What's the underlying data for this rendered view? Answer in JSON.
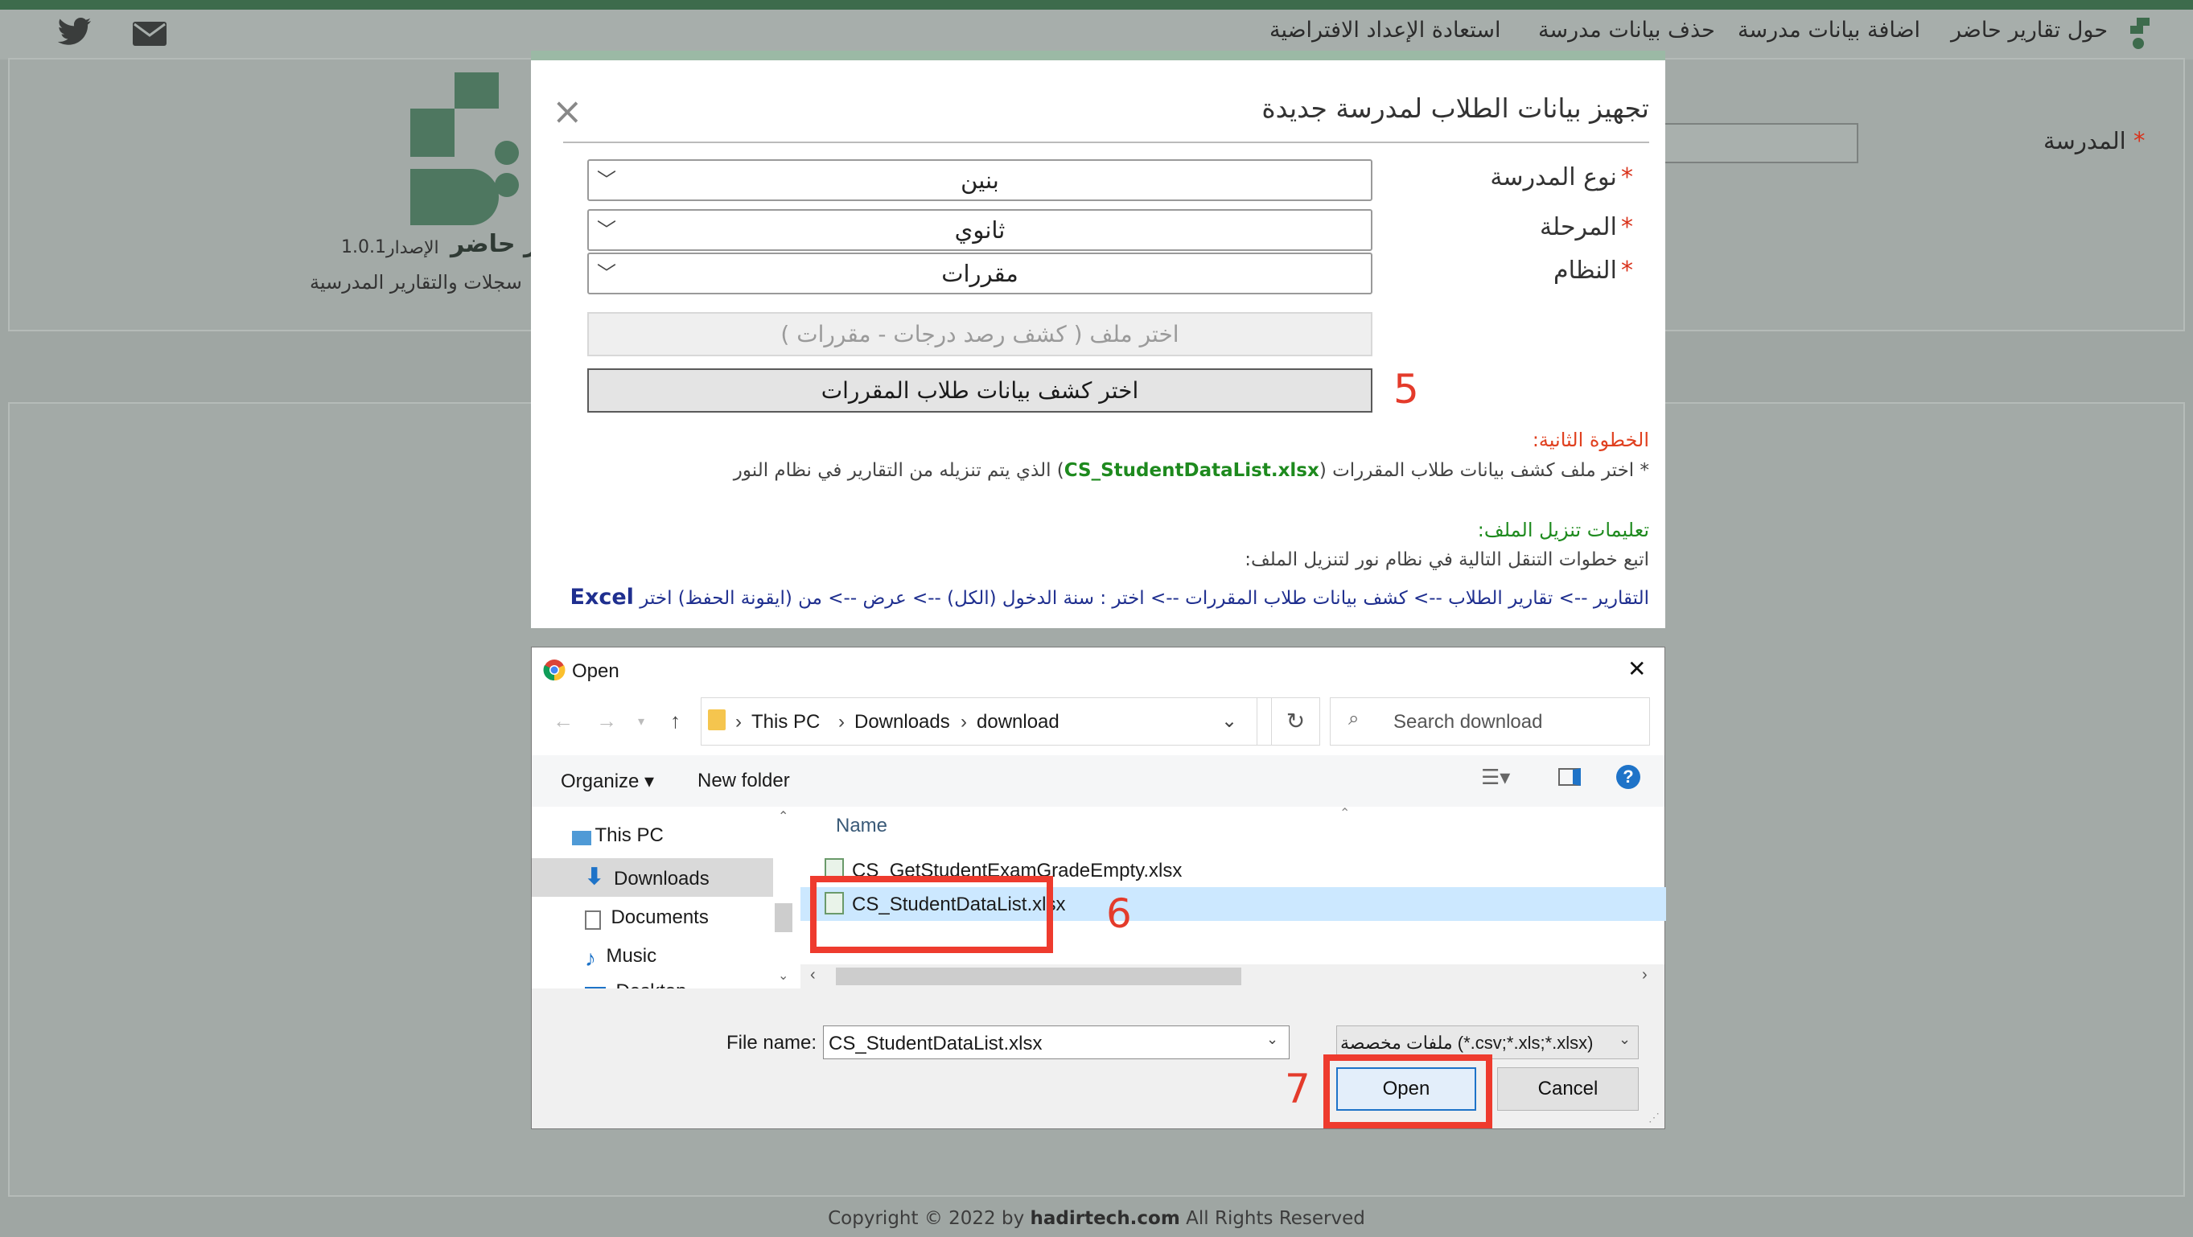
{
  "nav": {
    "items": [
      "حول تقارير حاضر",
      "اضافة بيانات مدرسة",
      "حذف بيانات مدرسة",
      "استعادة الإعداد الافتراضية"
    ]
  },
  "page": {
    "school_label": "المدرسة",
    "brand_name": "ير حاضر",
    "version_label": "الإصدار",
    "version_number": "1.0.1",
    "tagline": "سجلات والتقارير المدرسية"
  },
  "modal": {
    "title": "تجهيز بيانات الطلاب لمدرسة جديدة",
    "close_symbol": "×",
    "required_mark": "*",
    "fields": [
      {
        "label": "نوع المدرسة",
        "value": "بنين"
      },
      {
        "label": "المرحلة",
        "value": "ثانوي"
      },
      {
        "label": "النظام",
        "value": "مقررات"
      }
    ],
    "file_button_disabled": "اختر ملف ( كشف رصد درجات - مقررات )",
    "file_button_active": "اختر كشف بيانات طلاب المقررات",
    "step_heading": "الخطوة الثانية:",
    "step_text_before": "* اختر ملف كشف بيانات طلاب المقررات (",
    "step_filename": "CS_StudentDataList.xlsx",
    "step_text_after": ") الذي يتم تنزيله من التقارير في نظام النور",
    "download_heading": "تعليمات تنزيل الملف:",
    "download_intro": "اتبع خطوات التنقل التالية في نظام نور لتنزيل الملف:",
    "nav_path": "التقارير --> تقارير الطلاب --> كشف بيانات طلاب المقررات --> اختر : سنة الدخول (الكل) --> عرض --> من (ايقونة الحفظ) اختر",
    "nav_path_excel": "Excel"
  },
  "dialog": {
    "title": "Open",
    "close_symbol": "✕",
    "breadcrumb": [
      "This PC",
      "Downloads",
      "download"
    ],
    "search_placeholder": "Search download",
    "organize_label": "Organize ▾",
    "new_folder_label": "New folder",
    "help_symbol": "?",
    "sidebar": [
      "This PC",
      "Downloads",
      "Documents",
      "Music",
      "Desktop"
    ],
    "column_name": "Name",
    "files": [
      "CS_GetStudentExamGradeEmpty.xlsx",
      "CS_StudentDataList.xlsx"
    ],
    "filename_label": "File name:",
    "filename_value": "CS_StudentDataList.xlsx",
    "filetype_value": "ملفات مخصصة (*.csv;*.xls;*.xlsx)",
    "open_label": "Open",
    "cancel_label": "Cancel"
  },
  "annotations": [
    "5",
    "6",
    "7"
  ],
  "footer": {
    "prefix": "Copyright © 2022 by ",
    "site": "hadirtech.com",
    "suffix": " All Rights Reserved"
  },
  "colors": {
    "brand_green": "#3d6b4c",
    "annotation_red": "#ee3b2e",
    "step_heading": "#e0401f",
    "download_heading": "#1e8a1e",
    "nav_path_text": "#1f2f8f",
    "selected_row": "#cce8ff"
  }
}
